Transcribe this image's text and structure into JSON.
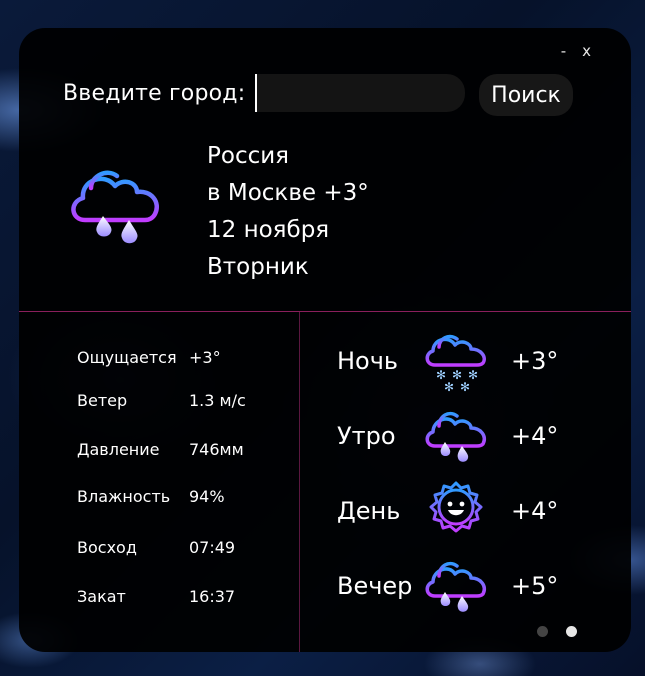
{
  "window": {
    "minimize_label": "-",
    "close_label": "x"
  },
  "search": {
    "label": "Введите город:",
    "value": "",
    "placeholder": "",
    "button_label": "Поиск"
  },
  "current": {
    "icon": "cloud-rain-icon",
    "country": "Россия",
    "city_temp": "в Москве +3°",
    "date": "12 ноября",
    "weekday": "Вторник"
  },
  "details": [
    {
      "label": "Ощущается",
      "value": "+3°"
    },
    {
      "label": "Ветер",
      "value": "1.3 м/с"
    },
    {
      "label": "Давление",
      "value": "746мм"
    },
    {
      "label": "Влажность",
      "value": "94%"
    },
    {
      "label": "Восход",
      "value": "07:49"
    },
    {
      "label": "Закат",
      "value": "16:37"
    }
  ],
  "forecast": [
    {
      "label": "Ночь",
      "icon": "cloud-snow-icon",
      "temp": "+3°"
    },
    {
      "label": "Утро",
      "icon": "cloud-rain-icon",
      "temp": "+4°"
    },
    {
      "label": "День",
      "icon": "sun-icon",
      "temp": "+4°"
    },
    {
      "label": "Вечер",
      "icon": "cloud-rain-icon",
      "temp": "+5°"
    }
  ],
  "pager": {
    "pages": 2,
    "active": 2
  },
  "colors": {
    "accent_blue": "#3aa0ff",
    "accent_purple": "#b03cff",
    "divider": "#8a1f5c"
  }
}
